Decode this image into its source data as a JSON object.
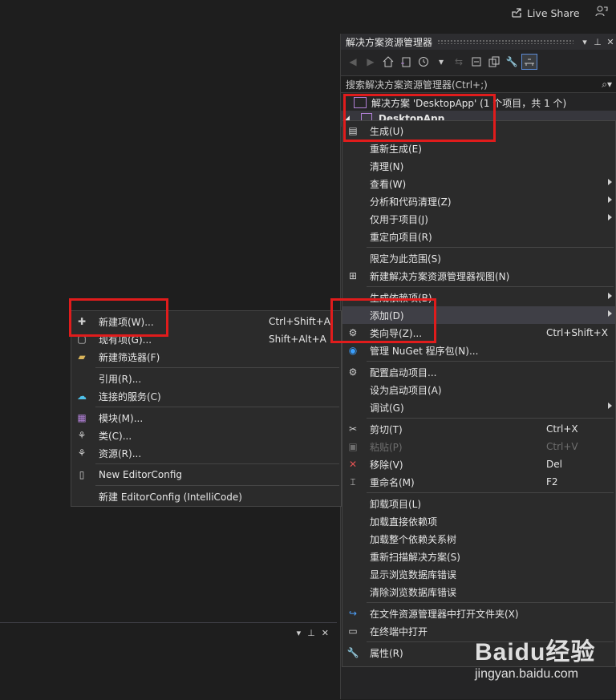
{
  "topbar": {
    "live_share": "Live Share"
  },
  "solution_explorer": {
    "title": "解决方案资源管理器",
    "search_placeholder": "搜索解决方案资源管理器(Ctrl+;)",
    "solution_label": "解决方案 'DesktopApp' (1 个项目，共 1 个)",
    "project_label": "DesktopApp"
  },
  "project_menu": [
    {
      "label": "生成(U)",
      "icon": "build-icon"
    },
    {
      "label": "重新生成(E)"
    },
    {
      "label": "清理(N)"
    },
    {
      "label": "查看(W)",
      "submenu": true
    },
    {
      "label": "分析和代码清理(Z)",
      "submenu": true
    },
    {
      "label": "仅用于项目(J)",
      "submenu": true
    },
    {
      "label": "重定向项目(R)"
    },
    {
      "separator": true
    },
    {
      "label": "限定为此范围(S)"
    },
    {
      "label": "新建解决方案资源管理器视图(N)",
      "icon": "new-view-icon"
    },
    {
      "separator": true
    },
    {
      "label": "生成依赖项(B)",
      "submenu": true
    },
    {
      "label": "添加(D)",
      "submenu": true,
      "highlighted": true
    },
    {
      "label": "类向导(Z)...",
      "shortcut": "Ctrl+Shift+X",
      "icon": "class-wizard-icon"
    },
    {
      "label": "管理 NuGet 程序包(N)...",
      "icon": "nuget-icon"
    },
    {
      "separator": true
    },
    {
      "label": "配置启动项目...",
      "icon": "gear-icon"
    },
    {
      "label": "设为启动项目(A)"
    },
    {
      "label": "调试(G)",
      "submenu": true
    },
    {
      "separator": true
    },
    {
      "label": "剪切(T)",
      "shortcut": "Ctrl+X",
      "icon": "cut-icon"
    },
    {
      "label": "粘贴(P)",
      "shortcut": "Ctrl+V",
      "icon": "paste-icon",
      "disabled": true
    },
    {
      "label": "移除(V)",
      "shortcut": "Del",
      "icon": "remove-icon"
    },
    {
      "label": "重命名(M)",
      "shortcut": "F2",
      "icon": "rename-icon"
    },
    {
      "separator": true
    },
    {
      "label": "卸载项目(L)"
    },
    {
      "label": "加载直接依赖项"
    },
    {
      "label": "加载整个依赖关系树"
    },
    {
      "label": "重新扫描解决方案(S)"
    },
    {
      "label": "显示浏览数据库错误"
    },
    {
      "label": "清除浏览数据库错误"
    },
    {
      "separator": true
    },
    {
      "label": "在文件资源管理器中打开文件夹(X)",
      "icon": "open-folder-icon"
    },
    {
      "label": "在终端中打开",
      "icon": "terminal-icon"
    },
    {
      "separator": true
    },
    {
      "label": "属性(R)",
      "icon": "wrench-icon"
    }
  ],
  "add_submenu": [
    {
      "label": "新建项(W)...",
      "shortcut": "Ctrl+Shift+A",
      "icon": "new-item-icon"
    },
    {
      "label": "现有项(G)...",
      "shortcut": "Shift+Alt+A",
      "icon": "existing-item-icon"
    },
    {
      "label": "新建筛选器(F)",
      "icon": "filter-folder-icon"
    },
    {
      "separator": true
    },
    {
      "label": "引用(R)..."
    },
    {
      "label": "连接的服务(C)",
      "icon": "connected-service-icon"
    },
    {
      "separator": true
    },
    {
      "label": "模块(M)...",
      "icon": "module-icon"
    },
    {
      "label": "类(C)...",
      "icon": "class-icon"
    },
    {
      "label": "资源(R)...",
      "icon": "resource-icon"
    },
    {
      "separator": true
    },
    {
      "label": "New EditorConfig",
      "icon": "file-icon"
    },
    {
      "separator": true
    },
    {
      "label": "新建 EditorConfig (IntelliCode)"
    }
  ],
  "watermark": {
    "logo": "Baidu经验",
    "url": "jingyan.baidu.com"
  }
}
